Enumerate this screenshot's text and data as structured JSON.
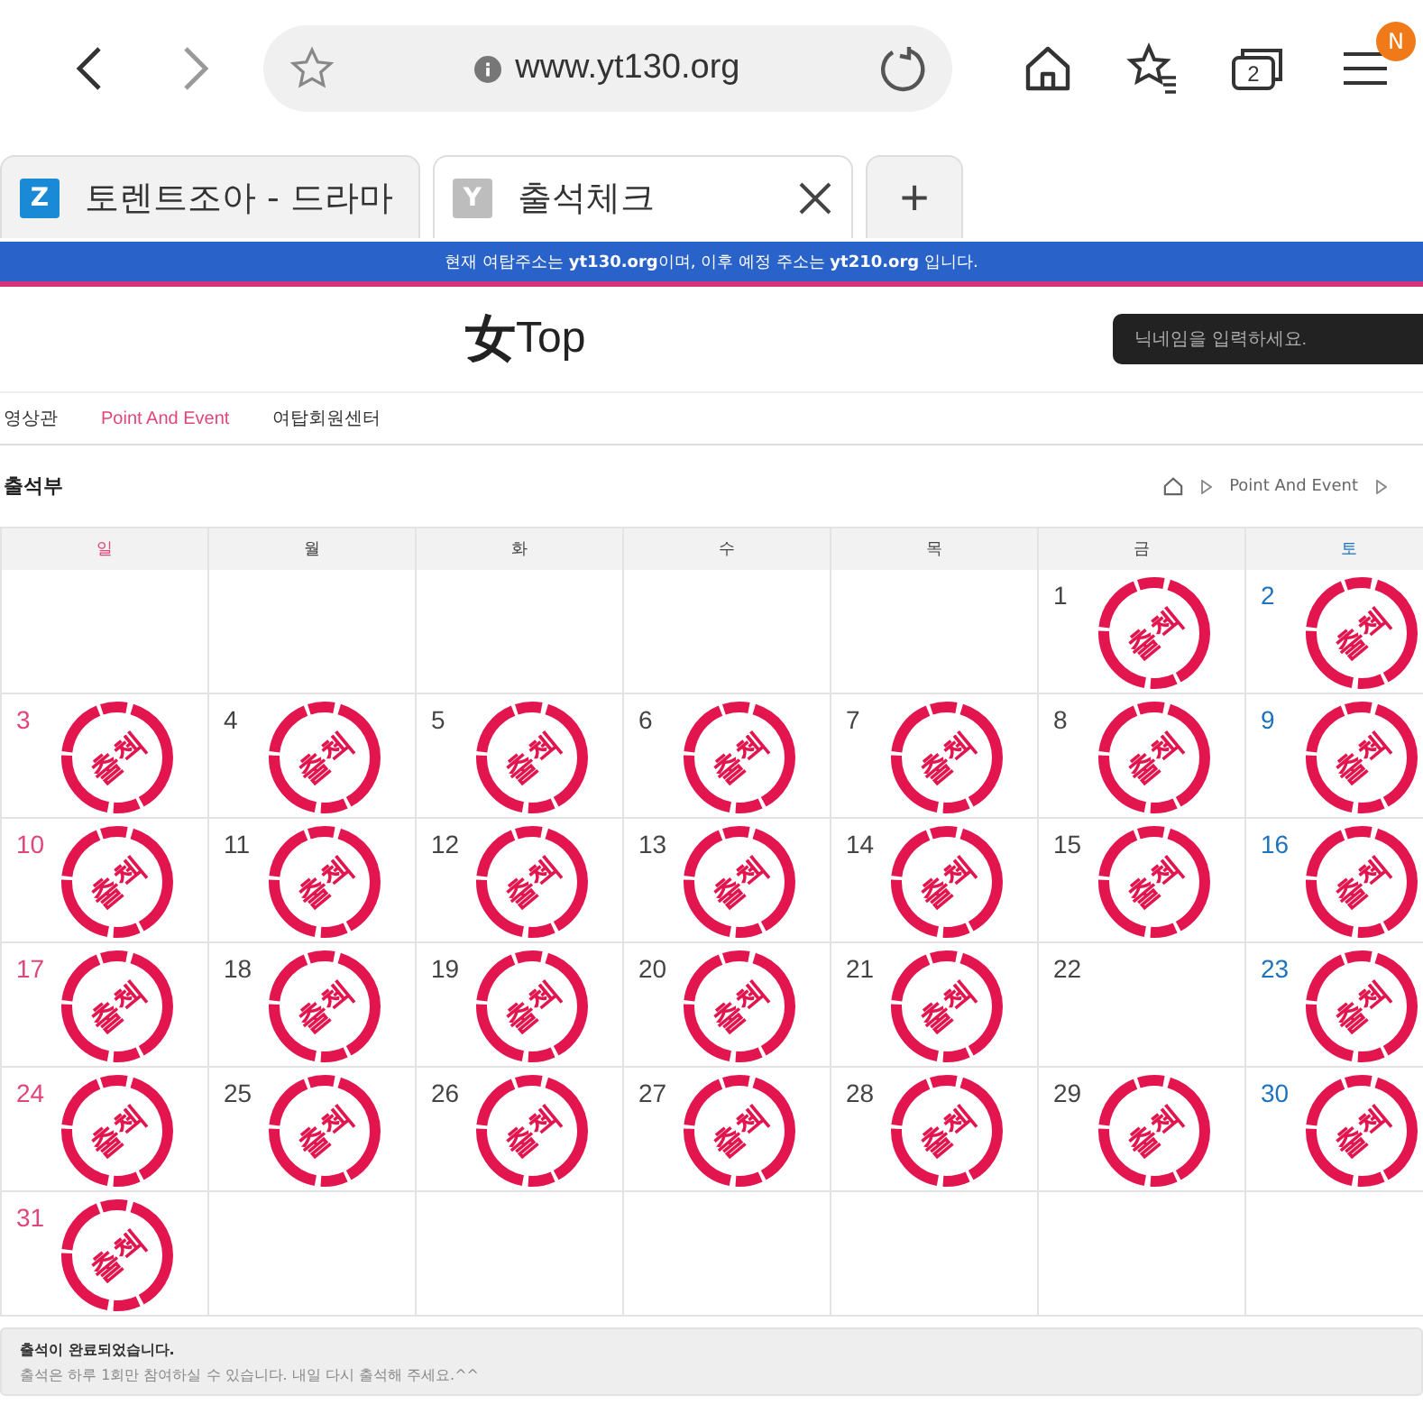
{
  "browser": {
    "url": "www.yt130.org",
    "tab_count": "2",
    "menu_badge": "N",
    "tabs": [
      {
        "favicon": "Z",
        "title": "토렌트조아 - 드라마",
        "selected": false
      },
      {
        "favicon": "Y",
        "title": "출석체크",
        "selected": true
      }
    ],
    "new_tab": "+"
  },
  "banner": "현재 여탑주소는 **yt130.org**이며, 이후 예정 주소는 **yt210.org** 입니다.",
  "header": {
    "logo_mark": "女",
    "logo_text": "Top",
    "search": {
      "placeholder": "닉네임을 입력하세요."
    }
  },
  "nav": [
    {
      "label": "영상관",
      "selected": false
    },
    {
      "label": "Point And Event",
      "selected": true
    },
    {
      "label": "여탑회원센터",
      "selected": false
    }
  ],
  "page_title": "출석부",
  "breadcrumb": [
    "Point And Event"
  ],
  "weekdays": [
    {
      "label": "일",
      "color": "#e0457b"
    },
    {
      "label": "월",
      "color": "#444444"
    },
    {
      "label": "화",
      "color": "#444444"
    },
    {
      "label": "수",
      "color": "#444444"
    },
    {
      "label": "목",
      "color": "#444444"
    },
    {
      "label": "금",
      "color": "#444444"
    },
    {
      "label": "토",
      "color": "#1e73be"
    }
  ],
  "weeks": [
    [
      {
        "kind": "empty"
      },
      {
        "kind": "empty"
      },
      {
        "kind": "empty"
      },
      {
        "kind": "empty"
      },
      {
        "kind": "empty"
      },
      {
        "kind": "day",
        "day": "1",
        "checked": true,
        "stamp": "출첵"
      },
      {
        "kind": "day",
        "day": "2",
        "checked": true,
        "stamp": "출첵"
      }
    ],
    [
      {
        "kind": "day",
        "day": "3",
        "checked": true,
        "stamp": "출첵"
      },
      {
        "kind": "day",
        "day": "4",
        "checked": true,
        "stamp": "출첵"
      },
      {
        "kind": "day",
        "day": "5",
        "checked": true,
        "stamp": "출첵"
      },
      {
        "kind": "day",
        "day": "6",
        "checked": true,
        "stamp": "출첵"
      },
      {
        "kind": "day",
        "day": "7",
        "checked": true,
        "stamp": "출첵"
      },
      {
        "kind": "day",
        "day": "8",
        "checked": true,
        "stamp": "출첵"
      },
      {
        "kind": "day",
        "day": "9",
        "checked": true,
        "stamp": "출첵"
      }
    ],
    [
      {
        "kind": "day",
        "day": "10",
        "checked": true,
        "stamp": "출첵"
      },
      {
        "kind": "day",
        "day": "11",
        "checked": true,
        "stamp": "출첵"
      },
      {
        "kind": "day",
        "day": "12",
        "checked": true,
        "stamp": "출첵"
      },
      {
        "kind": "day",
        "day": "13",
        "checked": true,
        "stamp": "출첵"
      },
      {
        "kind": "day",
        "day": "14",
        "checked": true,
        "stamp": "출첵"
      },
      {
        "kind": "day",
        "day": "15",
        "checked": true,
        "stamp": "출첵"
      },
      {
        "kind": "day",
        "day": "16",
        "checked": true,
        "stamp": "출첵"
      }
    ],
    [
      {
        "kind": "day",
        "day": "17",
        "checked": true,
        "stamp": "출첵"
      },
      {
        "kind": "day",
        "day": "18",
        "checked": true,
        "stamp": "출첵"
      },
      {
        "kind": "day",
        "day": "19",
        "checked": true,
        "stamp": "출첵"
      },
      {
        "kind": "day",
        "day": "20",
        "checked": true,
        "stamp": "출첵"
      },
      {
        "kind": "day",
        "day": "21",
        "checked": true,
        "stamp": "출첵"
      },
      {
        "kind": "day",
        "day": "22",
        "checked": false
      },
      {
        "kind": "day",
        "day": "23",
        "checked": true,
        "stamp": "출첵"
      }
    ],
    [
      {
        "kind": "day",
        "day": "24",
        "checked": true,
        "stamp": "출첵"
      },
      {
        "kind": "day",
        "day": "25",
        "checked": true,
        "stamp": "출첵"
      },
      {
        "kind": "day",
        "day": "26",
        "checked": true,
        "stamp": "출첵"
      },
      {
        "kind": "day",
        "day": "27",
        "checked": true,
        "stamp": "출첵"
      },
      {
        "kind": "day",
        "day": "28",
        "checked": true,
        "stamp": "출첵"
      },
      {
        "kind": "day",
        "day": "29",
        "checked": true,
        "stamp": "출첵"
      },
      {
        "kind": "day",
        "day": "30",
        "checked": true,
        "stamp": "출첵"
      }
    ],
    [
      {
        "kind": "day",
        "day": "31",
        "checked": true,
        "stamp": "출첵"
      },
      {
        "kind": "empty"
      },
      {
        "kind": "empty"
      },
      {
        "kind": "empty"
      },
      {
        "kind": "empty"
      },
      {
        "kind": "empty"
      },
      {
        "kind": "empty"
      }
    ]
  ],
  "notice": {
    "title": "출석이 완료되었습니다.",
    "text": "출석은 하루 1회만 참여하실 수 있습니다. 내일 다시 출석해 주세요.^^"
  }
}
